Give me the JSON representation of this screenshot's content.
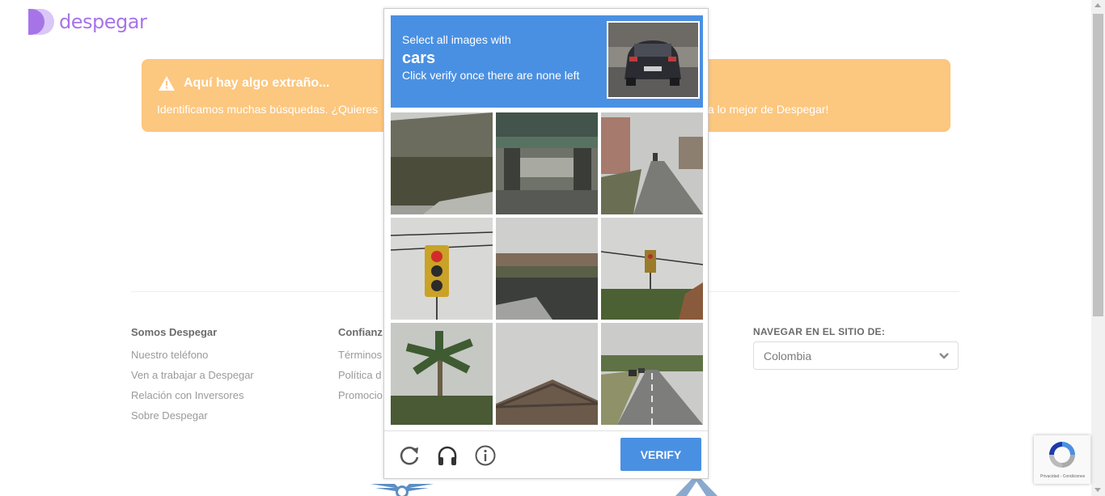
{
  "brand": {
    "name": "despegar",
    "color": "#a774e8"
  },
  "alert": {
    "title": "Aquí hay algo extraño...",
    "body_left": "Identificamos muchas búsquedas. ¿Quieres",
    "body_right": "a lo mejor de Despegar!",
    "bg_color": "#fcc77f"
  },
  "footer": {
    "col1": {
      "heading": "Somos Despegar",
      "links": [
        "Nuestro teléfono",
        "Ven a trabajar a Despegar",
        "Relación con Inversores",
        "Sobre Despegar"
      ]
    },
    "col2": {
      "heading": "Confianz",
      "links": [
        "Términos",
        "Política d",
        "Promocio"
      ]
    },
    "navigate": {
      "label": "NAVEGAR EN EL SITIO DE:",
      "selected": "Colombia"
    }
  },
  "captcha": {
    "instruction_line1": "Select all images with",
    "target": "cars",
    "instruction_line3": "Click verify once there are none left",
    "header_color": "#4a90e2",
    "tiles": [
      "tile-building-wall",
      "tile-overpass",
      "tile-street-road",
      "tile-traffic-light-red",
      "tile-parking-lot",
      "tile-traffic-light-trees",
      "tile-palm-trees",
      "tile-rooftop",
      "tile-highway-cars"
    ],
    "reload_icon": "reload-icon",
    "audio_icon": "headphones-icon",
    "info_icon": "info-icon",
    "verify_label": "VERIFY"
  },
  "recaptcha_badge": {
    "text": "Privacidad - Condiciones"
  }
}
